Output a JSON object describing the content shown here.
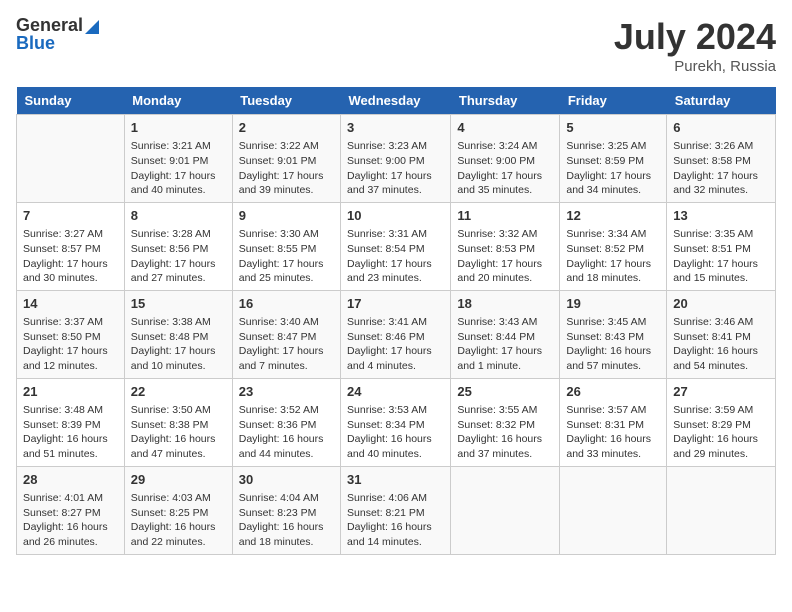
{
  "header": {
    "logo_general": "General",
    "logo_blue": "Blue",
    "month_year": "July 2024",
    "location": "Purekh, Russia"
  },
  "calendar": {
    "days_of_week": [
      "Sunday",
      "Monday",
      "Tuesday",
      "Wednesday",
      "Thursday",
      "Friday",
      "Saturday"
    ],
    "weeks": [
      [
        {
          "day": null,
          "info": null
        },
        {
          "day": "1",
          "sunrise": "Sunrise: 3:21 AM",
          "sunset": "Sunset: 9:01 PM",
          "daylight": "Daylight: 17 hours and 40 minutes."
        },
        {
          "day": "2",
          "sunrise": "Sunrise: 3:22 AM",
          "sunset": "Sunset: 9:01 PM",
          "daylight": "Daylight: 17 hours and 39 minutes."
        },
        {
          "day": "3",
          "sunrise": "Sunrise: 3:23 AM",
          "sunset": "Sunset: 9:00 PM",
          "daylight": "Daylight: 17 hours and 37 minutes."
        },
        {
          "day": "4",
          "sunrise": "Sunrise: 3:24 AM",
          "sunset": "Sunset: 9:00 PM",
          "daylight": "Daylight: 17 hours and 35 minutes."
        },
        {
          "day": "5",
          "sunrise": "Sunrise: 3:25 AM",
          "sunset": "Sunset: 8:59 PM",
          "daylight": "Daylight: 17 hours and 34 minutes."
        },
        {
          "day": "6",
          "sunrise": "Sunrise: 3:26 AM",
          "sunset": "Sunset: 8:58 PM",
          "daylight": "Daylight: 17 hours and 32 minutes."
        }
      ],
      [
        {
          "day": "7",
          "sunrise": "Sunrise: 3:27 AM",
          "sunset": "Sunset: 8:57 PM",
          "daylight": "Daylight: 17 hours and 30 minutes."
        },
        {
          "day": "8",
          "sunrise": "Sunrise: 3:28 AM",
          "sunset": "Sunset: 8:56 PM",
          "daylight": "Daylight: 17 hours and 27 minutes."
        },
        {
          "day": "9",
          "sunrise": "Sunrise: 3:30 AM",
          "sunset": "Sunset: 8:55 PM",
          "daylight": "Daylight: 17 hours and 25 minutes."
        },
        {
          "day": "10",
          "sunrise": "Sunrise: 3:31 AM",
          "sunset": "Sunset: 8:54 PM",
          "daylight": "Daylight: 17 hours and 23 minutes."
        },
        {
          "day": "11",
          "sunrise": "Sunrise: 3:32 AM",
          "sunset": "Sunset: 8:53 PM",
          "daylight": "Daylight: 17 hours and 20 minutes."
        },
        {
          "day": "12",
          "sunrise": "Sunrise: 3:34 AM",
          "sunset": "Sunset: 8:52 PM",
          "daylight": "Daylight: 17 hours and 18 minutes."
        },
        {
          "day": "13",
          "sunrise": "Sunrise: 3:35 AM",
          "sunset": "Sunset: 8:51 PM",
          "daylight": "Daylight: 17 hours and 15 minutes."
        }
      ],
      [
        {
          "day": "14",
          "sunrise": "Sunrise: 3:37 AM",
          "sunset": "Sunset: 8:50 PM",
          "daylight": "Daylight: 17 hours and 12 minutes."
        },
        {
          "day": "15",
          "sunrise": "Sunrise: 3:38 AM",
          "sunset": "Sunset: 8:48 PM",
          "daylight": "Daylight: 17 hours and 10 minutes."
        },
        {
          "day": "16",
          "sunrise": "Sunrise: 3:40 AM",
          "sunset": "Sunset: 8:47 PM",
          "daylight": "Daylight: 17 hours and 7 minutes."
        },
        {
          "day": "17",
          "sunrise": "Sunrise: 3:41 AM",
          "sunset": "Sunset: 8:46 PM",
          "daylight": "Daylight: 17 hours and 4 minutes."
        },
        {
          "day": "18",
          "sunrise": "Sunrise: 3:43 AM",
          "sunset": "Sunset: 8:44 PM",
          "daylight": "Daylight: 17 hours and 1 minute."
        },
        {
          "day": "19",
          "sunrise": "Sunrise: 3:45 AM",
          "sunset": "Sunset: 8:43 PM",
          "daylight": "Daylight: 16 hours and 57 minutes."
        },
        {
          "day": "20",
          "sunrise": "Sunrise: 3:46 AM",
          "sunset": "Sunset: 8:41 PM",
          "daylight": "Daylight: 16 hours and 54 minutes."
        }
      ],
      [
        {
          "day": "21",
          "sunrise": "Sunrise: 3:48 AM",
          "sunset": "Sunset: 8:39 PM",
          "daylight": "Daylight: 16 hours and 51 minutes."
        },
        {
          "day": "22",
          "sunrise": "Sunrise: 3:50 AM",
          "sunset": "Sunset: 8:38 PM",
          "daylight": "Daylight: 16 hours and 47 minutes."
        },
        {
          "day": "23",
          "sunrise": "Sunrise: 3:52 AM",
          "sunset": "Sunset: 8:36 PM",
          "daylight": "Daylight: 16 hours and 44 minutes."
        },
        {
          "day": "24",
          "sunrise": "Sunrise: 3:53 AM",
          "sunset": "Sunset: 8:34 PM",
          "daylight": "Daylight: 16 hours and 40 minutes."
        },
        {
          "day": "25",
          "sunrise": "Sunrise: 3:55 AM",
          "sunset": "Sunset: 8:32 PM",
          "daylight": "Daylight: 16 hours and 37 minutes."
        },
        {
          "day": "26",
          "sunrise": "Sunrise: 3:57 AM",
          "sunset": "Sunset: 8:31 PM",
          "daylight": "Daylight: 16 hours and 33 minutes."
        },
        {
          "day": "27",
          "sunrise": "Sunrise: 3:59 AM",
          "sunset": "Sunset: 8:29 PM",
          "daylight": "Daylight: 16 hours and 29 minutes."
        }
      ],
      [
        {
          "day": "28",
          "sunrise": "Sunrise: 4:01 AM",
          "sunset": "Sunset: 8:27 PM",
          "daylight": "Daylight: 16 hours and 26 minutes."
        },
        {
          "day": "29",
          "sunrise": "Sunrise: 4:03 AM",
          "sunset": "Sunset: 8:25 PM",
          "daylight": "Daylight: 16 hours and 22 minutes."
        },
        {
          "day": "30",
          "sunrise": "Sunrise: 4:04 AM",
          "sunset": "Sunset: 8:23 PM",
          "daylight": "Daylight: 16 hours and 18 minutes."
        },
        {
          "day": "31",
          "sunrise": "Sunrise: 4:06 AM",
          "sunset": "Sunset: 8:21 PM",
          "daylight": "Daylight: 16 hours and 14 minutes."
        },
        {
          "day": null,
          "info": null
        },
        {
          "day": null,
          "info": null
        },
        {
          "day": null,
          "info": null
        }
      ]
    ]
  }
}
